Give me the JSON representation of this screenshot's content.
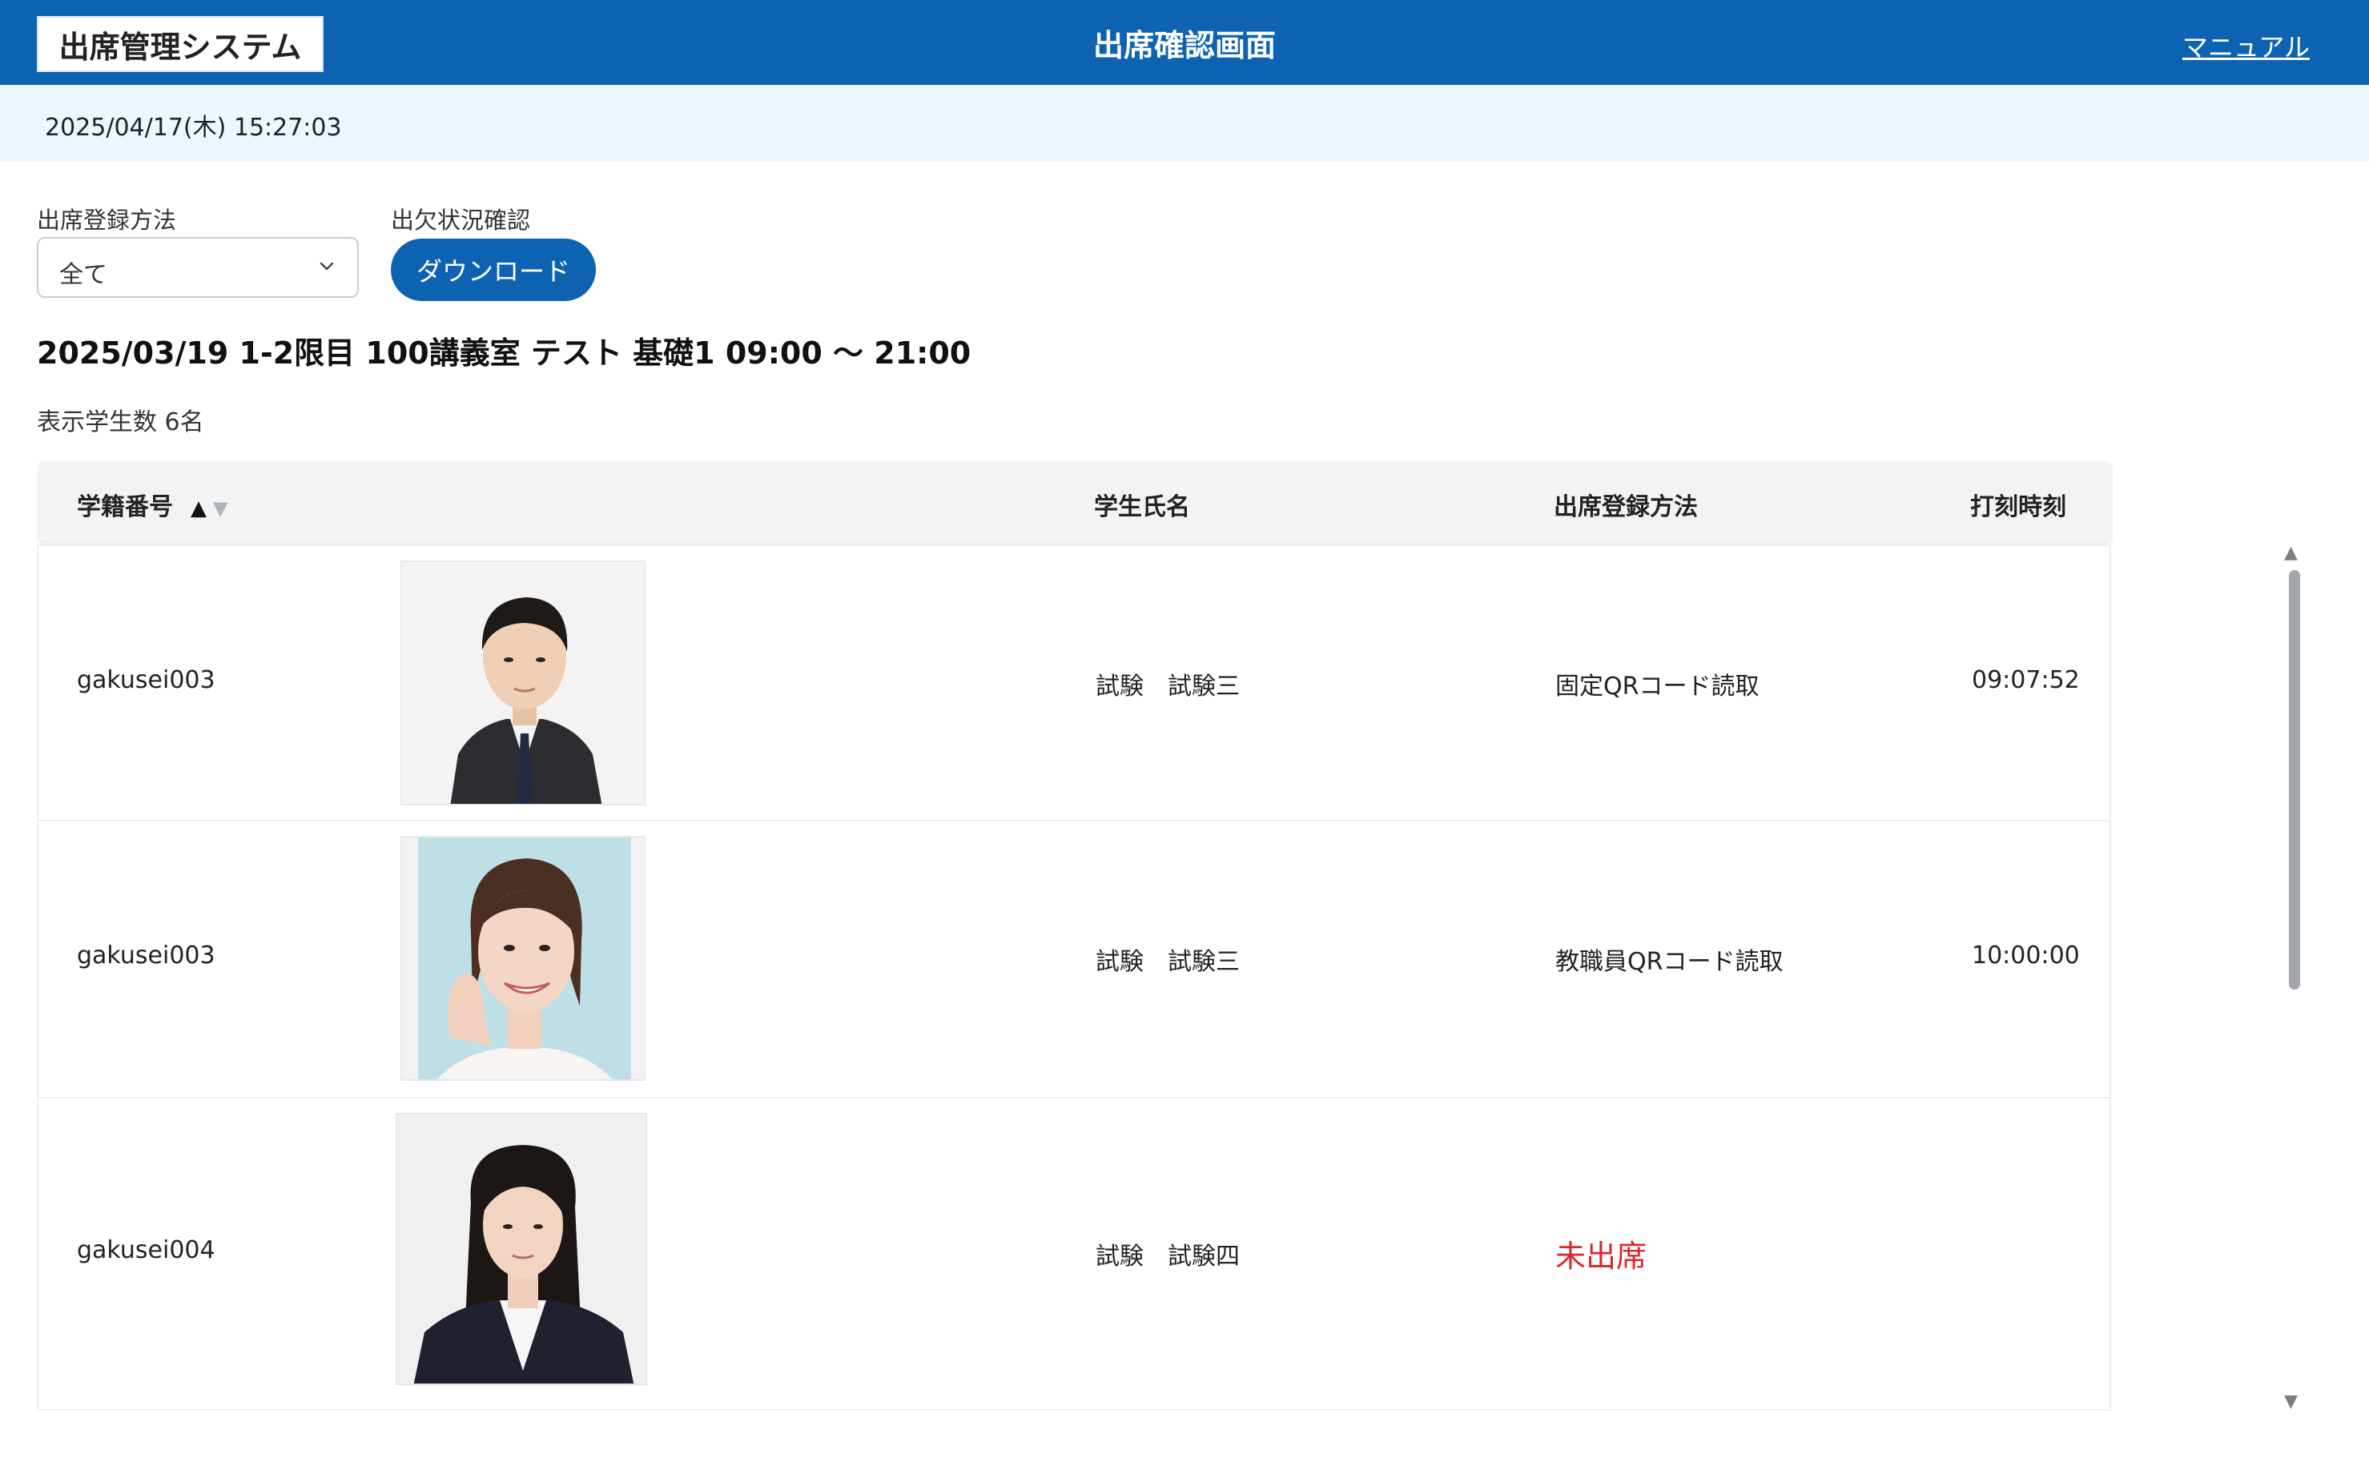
{
  "header": {
    "app_name": "出席管理システム",
    "page_title": "出席確認画面",
    "manual_link": "マニュアル",
    "background_color": "#0d63b1"
  },
  "datetime": "2025/04/17(木) 15:27:03",
  "filters": {
    "method_label": "出席登録方法",
    "method_value": "全て",
    "status_label": "出欠状況確認",
    "download_label": "ダウンロード"
  },
  "session": {
    "title": "2025/03/19 1-2限目 100講義室 テスト 基礎1 09:00 ～ 21:00",
    "count_text": "表示学生数 6名"
  },
  "table": {
    "headers": {
      "student_id": "学籍番号",
      "sort_asc": "▲",
      "sort_desc": "▼",
      "student_name": "学生氏名",
      "method": "出席登録方法",
      "time": "打刻時刻"
    },
    "rows": [
      {
        "student_id": "gakusei003",
        "name": "試験　試験三",
        "method": "固定QRコード読取",
        "time": "09:07:52",
        "photo_icon": "male-portrait-photo"
      },
      {
        "student_id": "gakusei003",
        "name": "試験　試験三",
        "method": "教職員QRコード読取",
        "time": "10:00:00",
        "photo_icon": "female-portrait-photo"
      },
      {
        "student_id": "gakusei004",
        "name": "試験　試験四",
        "method": "未出席",
        "time": "",
        "photo_icon": "female-portrait-photo",
        "method_color": "#e0242a"
      }
    ]
  },
  "scrollbar": {
    "up_arrow": "▲",
    "down_arrow": "▼"
  }
}
